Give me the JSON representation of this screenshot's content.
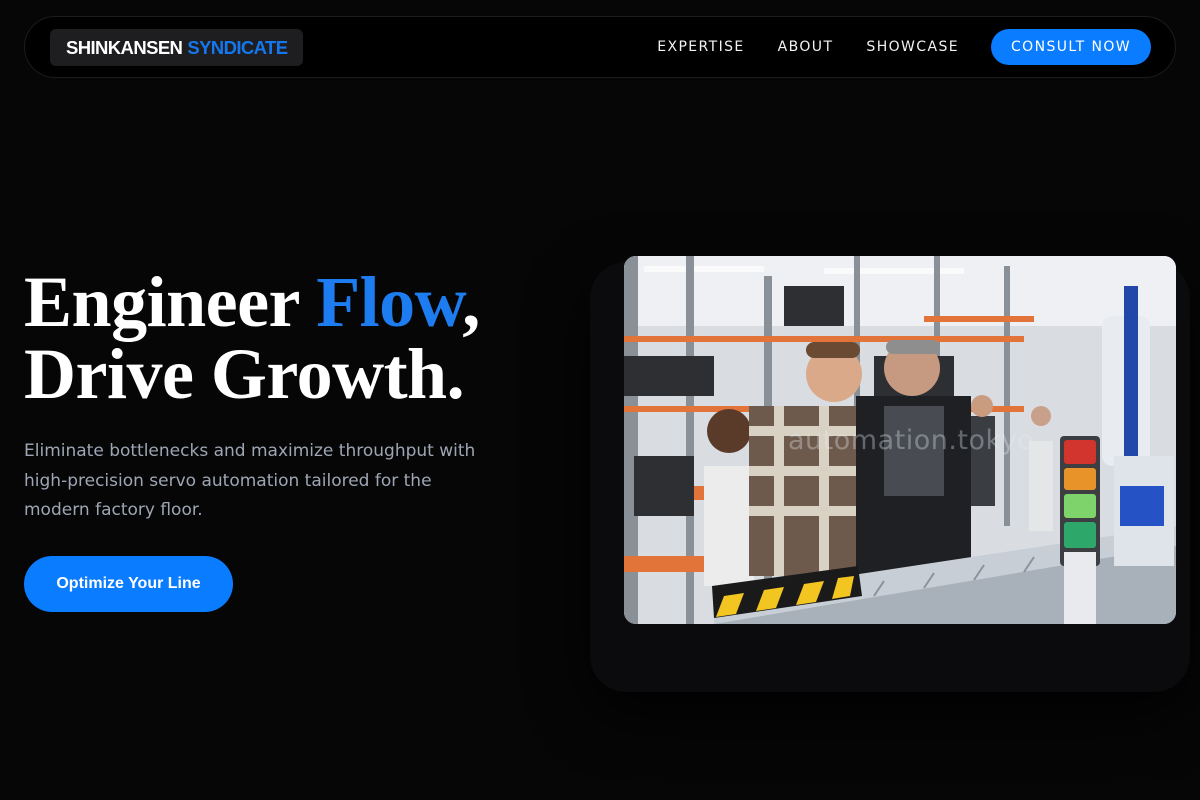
{
  "header": {
    "brand_primary": "SHINKANSEN",
    "brand_accent": "SYNDICATE",
    "nav": [
      "EXPERTISE",
      "ABOUT",
      "SHOWCASE"
    ],
    "cta_label": "CONSULT NOW"
  },
  "hero": {
    "headline_start": "Engineer ",
    "headline_accent": "Flow",
    "headline_punct": ",",
    "headline_line2": "Drive Growth.",
    "subcopy": "Eliminate bottlenecks and maximize throughput with high-precision servo automation tailored for the modern factory floor.",
    "button_label": "Optimize Your Line",
    "image_watermark": "automation.tokyo"
  },
  "colors": {
    "background": "#060607",
    "accent": "#0a7cff",
    "text": "#ffffff",
    "muted_text": "#9ea6b4"
  }
}
